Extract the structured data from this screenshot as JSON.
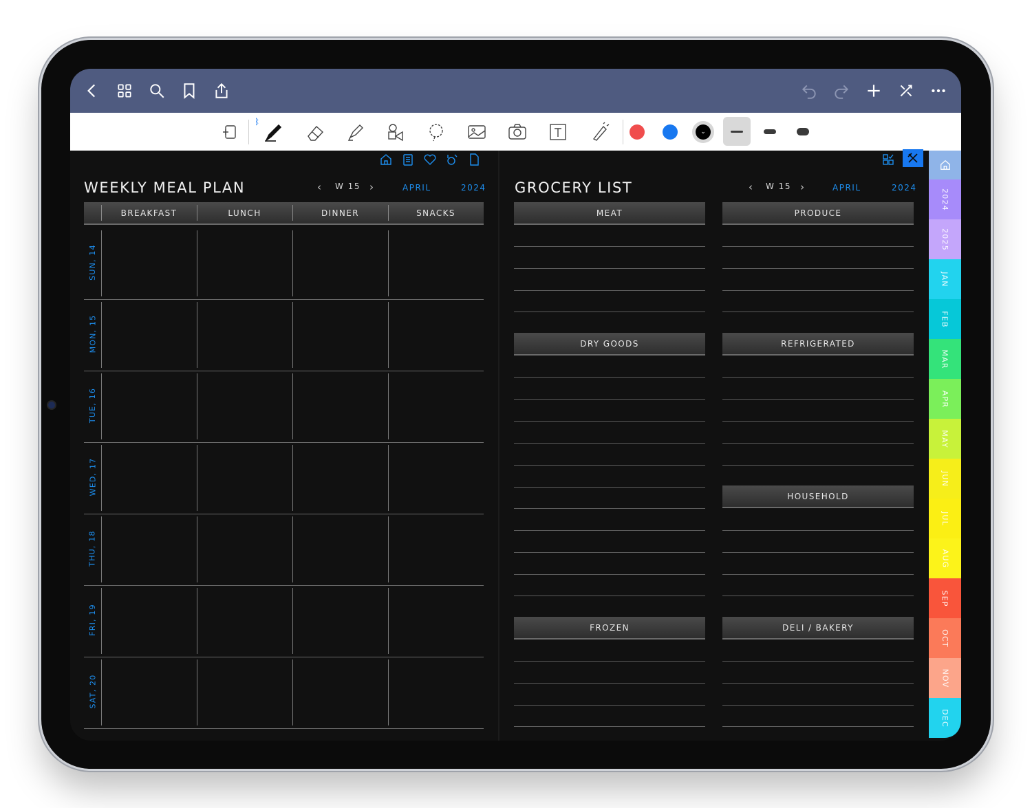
{
  "colors": {
    "navbar": "#4f5b80",
    "accent_blue": "#1d8ff0",
    "pen_red": "#f04d4d",
    "pen_blue": "#1878f0",
    "pen_black": "#000000"
  },
  "navbar": {
    "left_icons": [
      "back-chevron-icon",
      "grid-icon",
      "search-icon",
      "bookmark-icon",
      "share-icon"
    ],
    "right_icons": [
      "undo-icon",
      "redo-icon",
      "plus-icon",
      "collapse-icon",
      "more-icon"
    ]
  },
  "toolbar": {
    "tools": [
      "read-only-icon",
      "pen-icon",
      "eraser-icon",
      "highlighter-icon",
      "shapes-icon",
      "lasso-icon",
      "image-icon",
      "camera-icon",
      "text-icon",
      "laser-pointer-icon"
    ],
    "bluetooth_glyph": "ᛒ"
  },
  "meal_plan": {
    "title": "WEEKLY MEAL PLAN",
    "week": "W 15",
    "month": "APRIL",
    "year": "2024",
    "columns": [
      "BREAKFAST",
      "LUNCH",
      "DINNER",
      "SNACKS"
    ],
    "days": [
      "SUN, 14",
      "MON, 15",
      "TUE, 16",
      "WED, 17",
      "THU, 18",
      "FRI, 19",
      "SAT, 20"
    ]
  },
  "grocery": {
    "title": "GROCERY LIST",
    "week": "W 15",
    "month": "APRIL",
    "year": "2024",
    "groups": {
      "meat": "MEAT",
      "produce": "PRODUCE",
      "dry_goods": "DRY GOODS",
      "refrigerated": "REFRIGERATED",
      "household": "HOUSEHOLD",
      "frozen": "FROZEN",
      "deli_bakery": "DELI / BAKERY"
    }
  },
  "side_tabs": [
    {
      "label": "",
      "icon": "home-icon",
      "color": "#8fb4e8"
    },
    {
      "label": "2024",
      "color": "#a78bfa"
    },
    {
      "label": "2025",
      "color": "#c4a6fb"
    },
    {
      "label": "JAN",
      "color": "#22d3ee"
    },
    {
      "label": "FEB",
      "color": "#06c8d8"
    },
    {
      "label": "MAR",
      "color": "#34e37a"
    },
    {
      "label": "APR",
      "color": "#7bef5a"
    },
    {
      "label": "MAY",
      "color": "#c8f23a"
    },
    {
      "label": "JUN",
      "color": "#f6ee1a"
    },
    {
      "label": "JUL",
      "color": "#fbef14"
    },
    {
      "label": "AUG",
      "color": "#fcf31a"
    },
    {
      "label": "SEP",
      "color": "#f9553b"
    },
    {
      "label": "OCT",
      "color": "#fb7a59"
    },
    {
      "label": "NOV",
      "color": "#fca58a"
    },
    {
      "label": "DEC",
      "color": "#22d3ee"
    }
  ]
}
